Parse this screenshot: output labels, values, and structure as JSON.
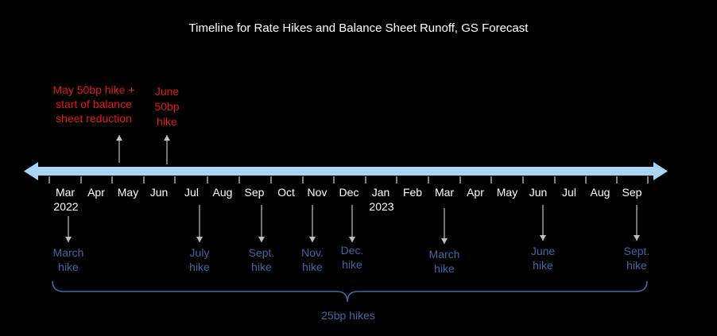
{
  "title": "Timeline for Rate Hikes and Balance Sheet Runoff, GS Forecast",
  "notes": {
    "may": [
      "May 50bp hike +",
      "start of balance",
      "sheet reduction"
    ],
    "june": [
      "June",
      "50bp",
      "hike"
    ]
  },
  "months": [
    "Mar",
    "Apr",
    "May",
    "Jun",
    "Jul",
    "Aug",
    "Sep",
    "Oct",
    "Nov",
    "Dec",
    "Jan",
    "Feb",
    "Mar",
    "Apr",
    "May",
    "Jun",
    "Jul",
    "Aug",
    "Sep"
  ],
  "years": [
    "2022",
    "2023"
  ],
  "hikes": [
    [
      "March",
      "hike"
    ],
    [
      "July",
      "hike"
    ],
    [
      "Sept.",
      "hike"
    ],
    [
      "Nov.",
      "hike"
    ],
    [
      "Dec.",
      "hike"
    ],
    [
      "March",
      "hike"
    ],
    [
      "June",
      "hike"
    ],
    [
      "Sept.",
      "hike"
    ]
  ],
  "footer": "25bp hikes",
  "colors": {
    "background": "#000000",
    "timeline": "#a9d4f5",
    "note": "#e01b1b",
    "hike_text": "#3f68a0",
    "arrow": "#bfbfbf"
  }
}
